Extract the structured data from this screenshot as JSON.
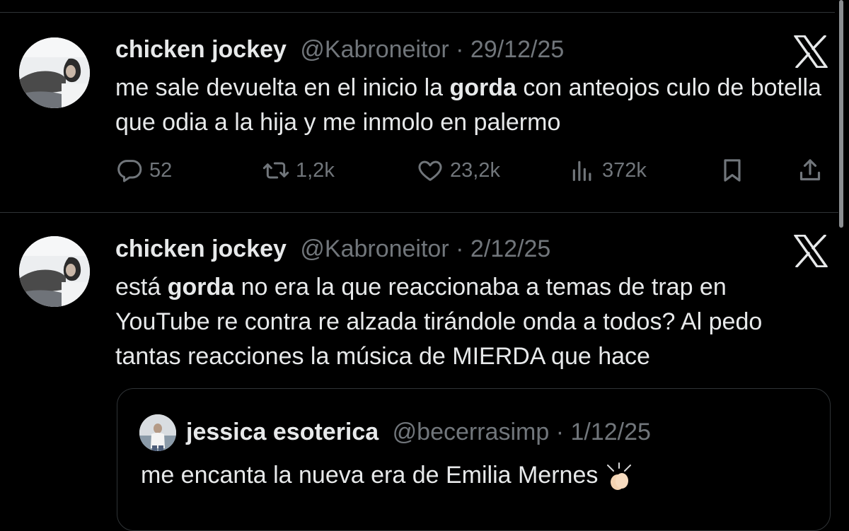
{
  "tweets": [
    {
      "name": "chicken jockey",
      "handle": "@Kabroneitor",
      "separator": "·",
      "date": "29/12/25",
      "text_parts": [
        "me sale devuelta en el inicio la ",
        "gorda",
        " con anteojos culo de botella que odia a la hija y me inmolo en palermo"
      ],
      "replies": "52",
      "reposts": "1,2k",
      "likes": "23,2k",
      "views": "372k"
    },
    {
      "name": "chicken jockey",
      "handle": "@Kabroneitor",
      "separator": "·",
      "date": "2/12/25",
      "text_parts": [
        "está ",
        "gorda",
        " no era la que reaccionaba a temas de trap en YouTube re contra re alzada tirándole onda a todos? Al pedo tantas reacciones la música de MIERDA que hace"
      ],
      "quote": {
        "name": "jessica esoterica",
        "handle": "@becerrasimp",
        "separator": "·",
        "date": "1/12/25",
        "text": "me encanta la nueva era de Emilia Mernes"
      }
    }
  ],
  "icons": {
    "x_logo": "x-logo-icon",
    "reply": "reply-icon",
    "repost": "repost-icon",
    "like": "like-icon",
    "views": "views-icon",
    "bookmark": "bookmark-icon",
    "share": "share-icon",
    "clap": "clapping-hands-emoji"
  },
  "colors": {
    "background": "#000000",
    "text": "#e7e9ea",
    "secondary": "#71767b",
    "border": "#2f3336"
  }
}
